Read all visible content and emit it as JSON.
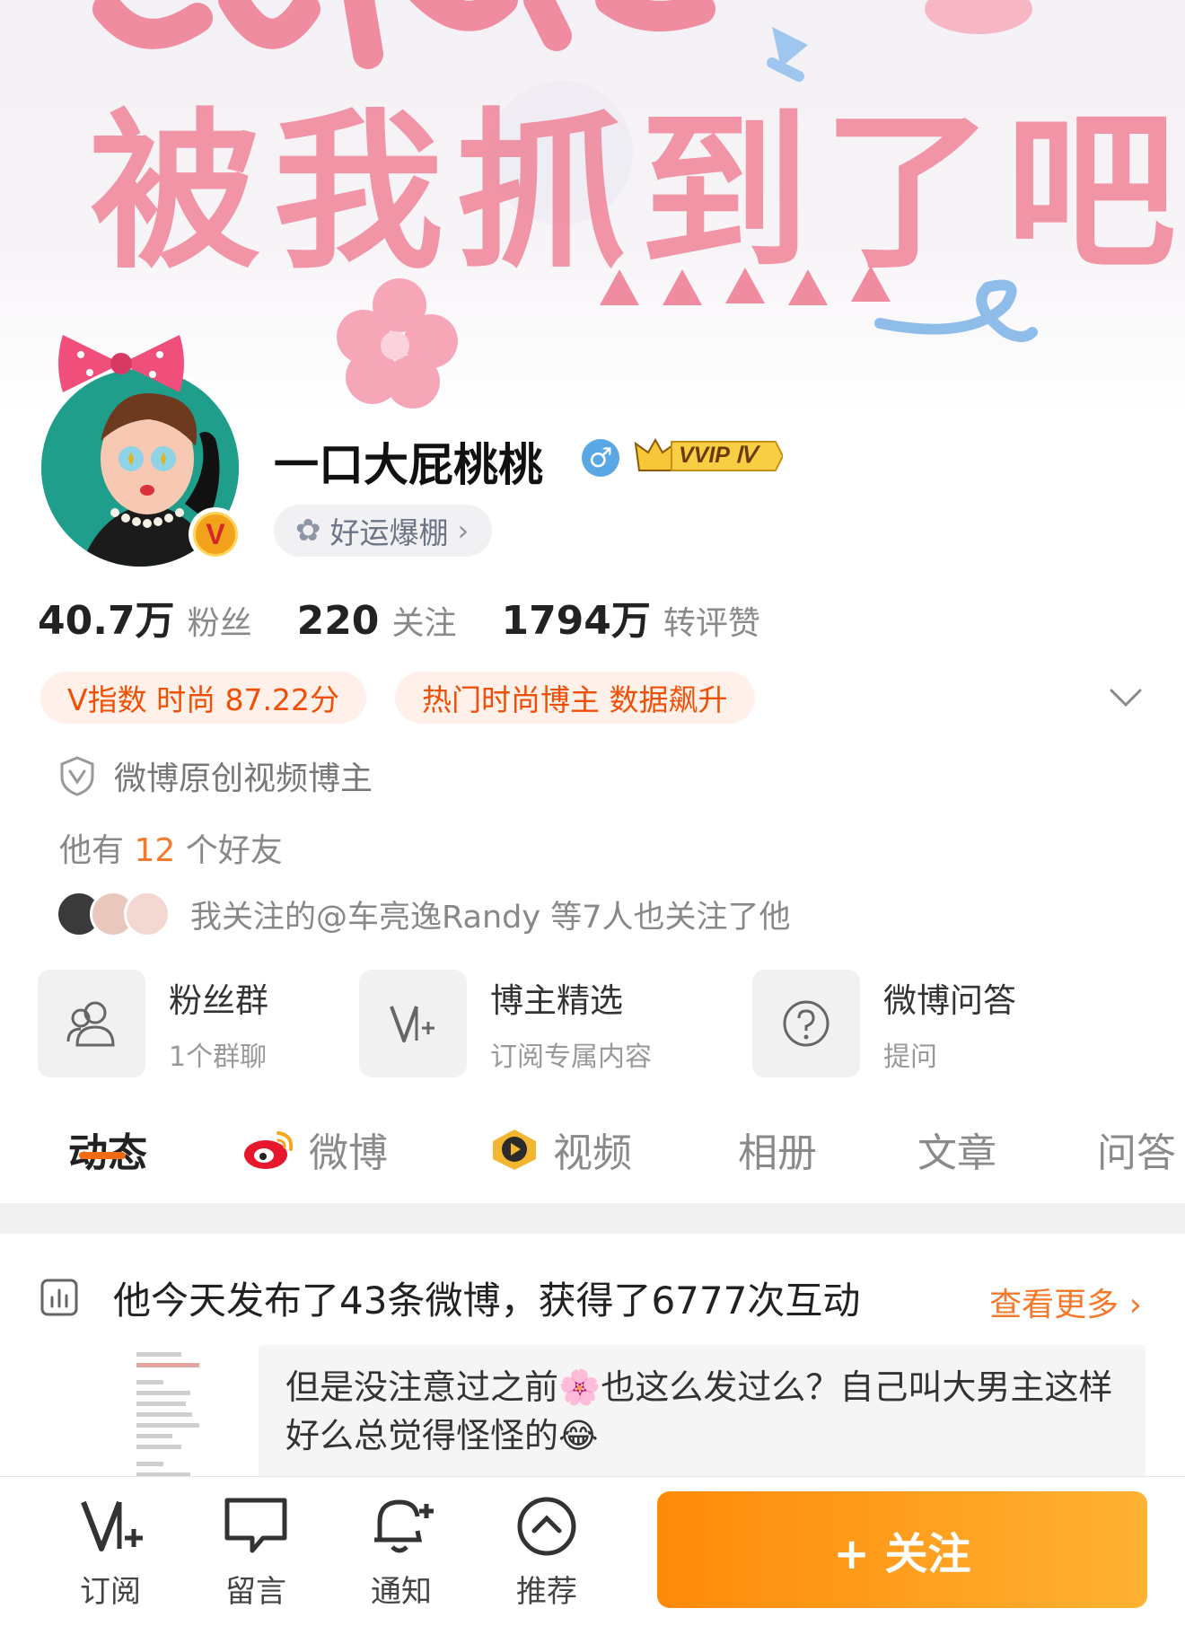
{
  "banner": {
    "line2": "被我抓到了吧"
  },
  "profile": {
    "name": "一口大屁桃桃",
    "gender_symbol": "♂",
    "vvip_text": "VVIP Ⅳ",
    "vbadge": "V",
    "luck_label": "好运爆棚",
    "luck_arrow": "›"
  },
  "stats": [
    {
      "num": "40.7万",
      "label": "粉丝"
    },
    {
      "num": "220",
      "label": "关注"
    },
    {
      "num": "1794万",
      "label": "转评赞"
    }
  ],
  "tags": [
    "V指数 时尚 87.22分",
    "热门时尚博主 数据飙升"
  ],
  "verification": "微博原创视频博主",
  "friends": {
    "prefix": "他有 ",
    "count": "12",
    "suffix": " 个好友"
  },
  "mutual": "我关注的@车亮逸Randy 等7人也关注了他",
  "features": [
    {
      "title": "粉丝群",
      "sub": "1个群聊",
      "icon": "people-icon"
    },
    {
      "title": "博主精选",
      "sub": "订阅专属内容",
      "icon": "v-plus-icon"
    },
    {
      "title": "微博问答",
      "sub": "提问",
      "icon": "question-icon"
    }
  ],
  "tabs": [
    "动态",
    "微博",
    "视频",
    "相册",
    "文章",
    "问答"
  ],
  "activity": {
    "text": "他今天发布了43条微博，获得了6777次互动",
    "more": "查看更多 ›"
  },
  "post": {
    "text": "但是没注意过之前🌸也这么发过么？自己叫大男主这样好么总觉得怪怪的😂"
  },
  "bottom_bar": {
    "items": [
      "订阅",
      "留言",
      "通知",
      "推荐"
    ],
    "follow": "+ 关注"
  },
  "colors": {
    "accent": "#f5792a",
    "follow_gradient_start": "#ff8a09",
    "follow_gradient_end": "#ffb233",
    "banner_text": "#f08ca0",
    "avatar_bg": "#1f9e8c"
  }
}
